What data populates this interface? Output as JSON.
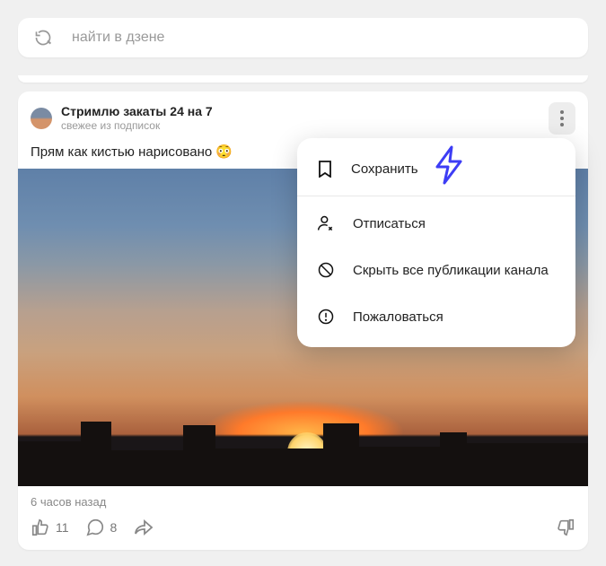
{
  "search": {
    "placeholder": "найти в дзене"
  },
  "post": {
    "author": "Стримлю закаты 24 на 7",
    "subtitle": "свежее из подписок",
    "text": "Прям как кистью нарисовано 😳",
    "timestamp": "6 часов назад",
    "likes": "11",
    "comments": "8"
  },
  "menu": {
    "save": "Сохранить",
    "unsubscribe": "Отписаться",
    "hide_all": "Скрыть все публикации канала",
    "report": "Пожаловаться"
  }
}
